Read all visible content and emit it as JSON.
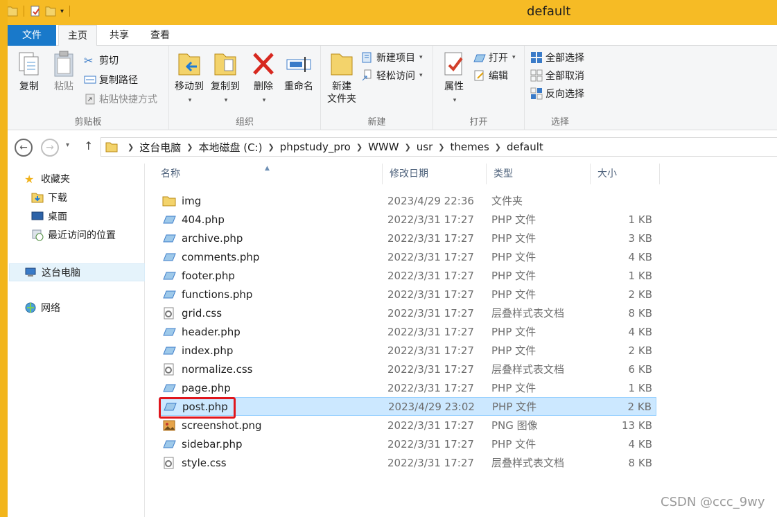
{
  "window": {
    "title": "default"
  },
  "colors": {
    "titlebar": "#f6bb25",
    "file_tab": "#1979ca",
    "selection": "#cce8ff",
    "highlight_box": "#e0161d"
  },
  "tabs": {
    "file": "文件",
    "home": "主页",
    "share": "共享",
    "view": "查看"
  },
  "ribbon": {
    "clipboard": {
      "label": "剪贴板",
      "copy": "复制",
      "paste": "粘贴",
      "cut": "剪切",
      "copy_path": "复制路径",
      "paste_shortcut": "粘贴快捷方式"
    },
    "organize": {
      "label": "组织",
      "move_to": "移动到",
      "copy_to": "复制到",
      "delete": "删除",
      "rename": "重命名"
    },
    "new": {
      "label": "新建",
      "new_folder_line1": "新建",
      "new_folder_line2": "文件夹",
      "new_item": "新建项目",
      "easy_access": "轻松访问"
    },
    "open": {
      "label": "打开",
      "properties": "属性",
      "open": "打开",
      "edit": "编辑"
    },
    "select": {
      "label": "选择",
      "select_all": "全部选择",
      "select_none": "全部取消",
      "invert": "反向选择"
    }
  },
  "address": {
    "crumbs": [
      "这台电脑",
      "本地磁盘 (C:)",
      "phpstudy_pro",
      "WWW",
      "usr",
      "themes",
      "default"
    ]
  },
  "nav": {
    "favorites": "收藏夹",
    "downloads": "下载",
    "desktop": "桌面",
    "recent": "最近访问的位置",
    "this_pc": "这台电脑",
    "network": "网络"
  },
  "columns": {
    "name": "名称",
    "date": "修改日期",
    "type": "类型",
    "size": "大小"
  },
  "files": [
    {
      "name": "img",
      "date": "2023/4/29 22:36",
      "type": "文件夹",
      "size": "",
      "icon": "folder-icon"
    },
    {
      "name": "404.php",
      "date": "2022/3/31 17:27",
      "type": "PHP 文件",
      "size": "1 KB",
      "icon": "php-file-icon"
    },
    {
      "name": "archive.php",
      "date": "2022/3/31 17:27",
      "type": "PHP 文件",
      "size": "3 KB",
      "icon": "php-file-icon"
    },
    {
      "name": "comments.php",
      "date": "2022/3/31 17:27",
      "type": "PHP 文件",
      "size": "4 KB",
      "icon": "php-file-icon"
    },
    {
      "name": "footer.php",
      "date": "2022/3/31 17:27",
      "type": "PHP 文件",
      "size": "1 KB",
      "icon": "php-file-icon"
    },
    {
      "name": "functions.php",
      "date": "2022/3/31 17:27",
      "type": "PHP 文件",
      "size": "2 KB",
      "icon": "php-file-icon"
    },
    {
      "name": "grid.css",
      "date": "2022/3/31 17:27",
      "type": "层叠样式表文档",
      "size": "8 KB",
      "icon": "css-file-icon"
    },
    {
      "name": "header.php",
      "date": "2022/3/31 17:27",
      "type": "PHP 文件",
      "size": "4 KB",
      "icon": "php-file-icon"
    },
    {
      "name": "index.php",
      "date": "2022/3/31 17:27",
      "type": "PHP 文件",
      "size": "2 KB",
      "icon": "php-file-icon"
    },
    {
      "name": "normalize.css",
      "date": "2022/3/31 17:27",
      "type": "层叠样式表文档",
      "size": "6 KB",
      "icon": "css-file-icon"
    },
    {
      "name": "page.php",
      "date": "2022/3/31 17:27",
      "type": "PHP 文件",
      "size": "1 KB",
      "icon": "php-file-icon"
    },
    {
      "name": "post.php",
      "date": "2023/4/29 23:02",
      "type": "PHP 文件",
      "size": "2 KB",
      "icon": "php-file-icon",
      "selected": true
    },
    {
      "name": "screenshot.png",
      "date": "2022/3/31 17:27",
      "type": "PNG 图像",
      "size": "13 KB",
      "icon": "png-file-icon"
    },
    {
      "name": "sidebar.php",
      "date": "2022/3/31 17:27",
      "type": "PHP 文件",
      "size": "4 KB",
      "icon": "php-file-icon"
    },
    {
      "name": "style.css",
      "date": "2022/3/31 17:27",
      "type": "层叠样式表文档",
      "size": "8 KB",
      "icon": "css-file-icon"
    }
  ],
  "watermark": "CSDN @ccc_9wy"
}
